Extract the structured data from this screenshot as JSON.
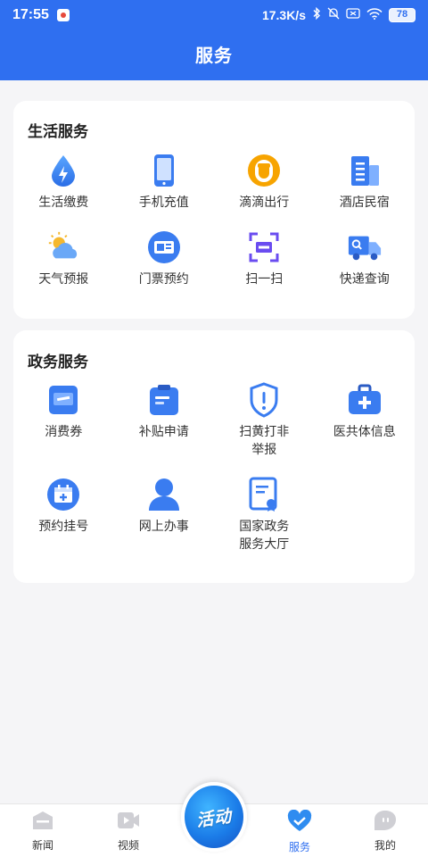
{
  "status_bar": {
    "time": "17:55",
    "network_speed": "17.3K/s",
    "battery": "78"
  },
  "header": {
    "title": "服务"
  },
  "life_services": {
    "title": "生活服务",
    "items": [
      {
        "label": "生活缴费",
        "icon": "water-drop-bolt-icon"
      },
      {
        "label": "手机充值",
        "icon": "phone-icon"
      },
      {
        "label": "滴滴出行",
        "icon": "didi-icon"
      },
      {
        "label": "酒店民宿",
        "icon": "hotel-building-icon"
      },
      {
        "label": "天气预报",
        "icon": "weather-icon"
      },
      {
        "label": "门票预约",
        "icon": "ticket-icon"
      },
      {
        "label": "扫一扫",
        "icon": "scan-icon"
      },
      {
        "label": "快递查询",
        "icon": "delivery-truck-icon"
      }
    ]
  },
  "gov_services": {
    "title": "政务服务",
    "items": [
      {
        "label": "消费券",
        "icon": "coupon-icon"
      },
      {
        "label": "补贴申请",
        "icon": "clipboard-icon"
      },
      {
        "label": "扫黄打非举报",
        "label_line1": "扫黄打非",
        "label_line2": "举报",
        "icon": "shield-alert-icon"
      },
      {
        "label": "医共体信息",
        "icon": "medical-kit-icon"
      },
      {
        "label": "预约挂号",
        "icon": "calendar-plus-icon"
      },
      {
        "label": "网上办事",
        "icon": "user-icon"
      },
      {
        "label": "国家政务服务大厅",
        "label_line1": "国家政务",
        "label_line2": "服务大厅",
        "icon": "certificate-icon"
      }
    ]
  },
  "tab_bar": {
    "tabs": [
      {
        "label": "新闻",
        "icon": "news-icon"
      },
      {
        "label": "视频",
        "icon": "video-icon"
      },
      {
        "label": "服务",
        "icon": "heart-check-icon",
        "active": true
      },
      {
        "label": "我的",
        "icon": "profile-icon"
      }
    ],
    "center_button": "活动"
  },
  "colors": {
    "primary": "#2f6ff0",
    "didi_orange": "#f7a400",
    "background": "#f5f5f7"
  }
}
